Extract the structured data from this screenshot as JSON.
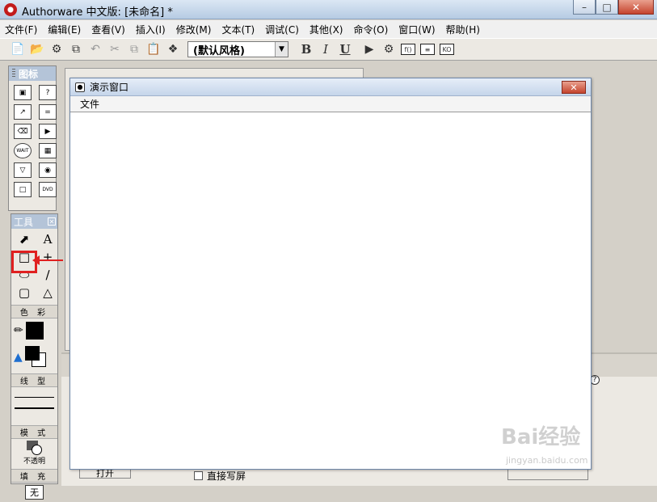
{
  "window": {
    "title": "Authorware 中文版: [未命名] *",
    "minimize": "–",
    "maximize": "□",
    "close": "✕"
  },
  "menu": [
    "文件(F)",
    "编辑(E)",
    "查看(V)",
    "插入(I)",
    "修改(M)",
    "文本(T)",
    "调试(C)",
    "其他(X)",
    "命令(O)",
    "窗口(W)",
    "帮助(H)"
  ],
  "toolbar": {
    "style_select": "(默认风格)",
    "bold": "B",
    "italic": "I",
    "underline": "U"
  },
  "icon_palette": {
    "title": "图标"
  },
  "tool_palette": {
    "title": "工具",
    "color_label": "色 彩",
    "line_label": "线 型",
    "mode_label": "模 式",
    "mode_value": "不透明",
    "fill_label": "填 充",
    "fill_value": "无"
  },
  "demo_window": {
    "title": "演示窗口",
    "menu_file": "文件"
  },
  "bottom": {
    "open_button": "打开",
    "direct_screen": "直接写屏"
  },
  "watermark": {
    "brand": "Bai经验",
    "url": "jingyan.baidu.com"
  }
}
